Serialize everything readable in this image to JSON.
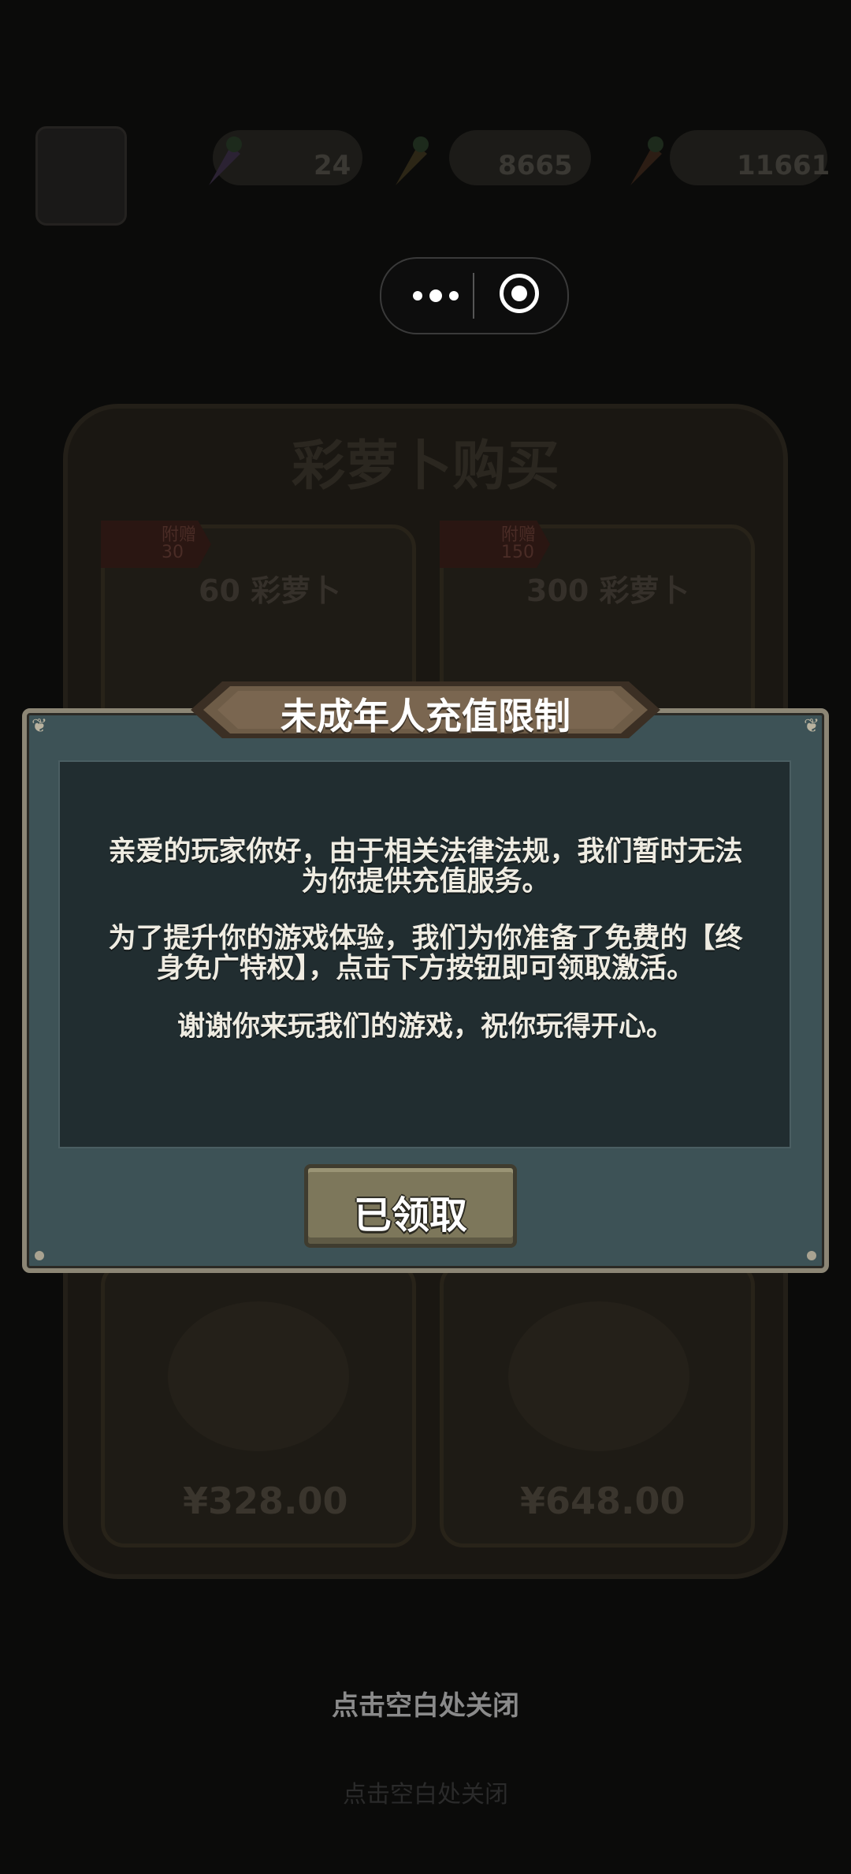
{
  "resources": [
    {
      "name": "rainbow-carrot",
      "value": "24",
      "color": "#9a5ac8"
    },
    {
      "name": "gold-carrot",
      "value": "8665",
      "color": "#c49a2a"
    },
    {
      "name": "carrot",
      "value": "11661",
      "color": "#d06a22"
    }
  ],
  "menu_capsule": {
    "more_icon": "more-dots-icon",
    "close_icon": "record-circle-icon"
  },
  "shop": {
    "title": "彩萝卜购买",
    "items": [
      {
        "bonus_label": "附赠",
        "bonus_value": "30",
        "label": "60 彩萝卜",
        "price": ""
      },
      {
        "bonus_label": "附赠",
        "bonus_value": "150",
        "label": "300 彩萝卜",
        "price": ""
      },
      {
        "label": "",
        "price": "¥328.00"
      },
      {
        "label": "",
        "price": "¥648.00"
      }
    ]
  },
  "modal": {
    "title": "未成年人充值限制",
    "line1": "亲爱的玩家你好，由于相关法律法规，我们暂时无法",
    "line2": "为你提供充值服务。",
    "line3": "为了提升你的游戏体验，我们为你准备了免费的【终",
    "line4": "身免广特权】，点击下方按钮即可领取激活。",
    "line5": "谢谢你来玩我们的游戏，祝你玩得开心。",
    "button_label": "已领取"
  },
  "close_hint": "点击空白处关闭",
  "close_hint_bg": "点击空白处关闭",
  "colors": {
    "modal_bg": "#3d5256",
    "panel_bg": "#212d30",
    "button": "#7d775b",
    "banner": "#6e5c47"
  }
}
